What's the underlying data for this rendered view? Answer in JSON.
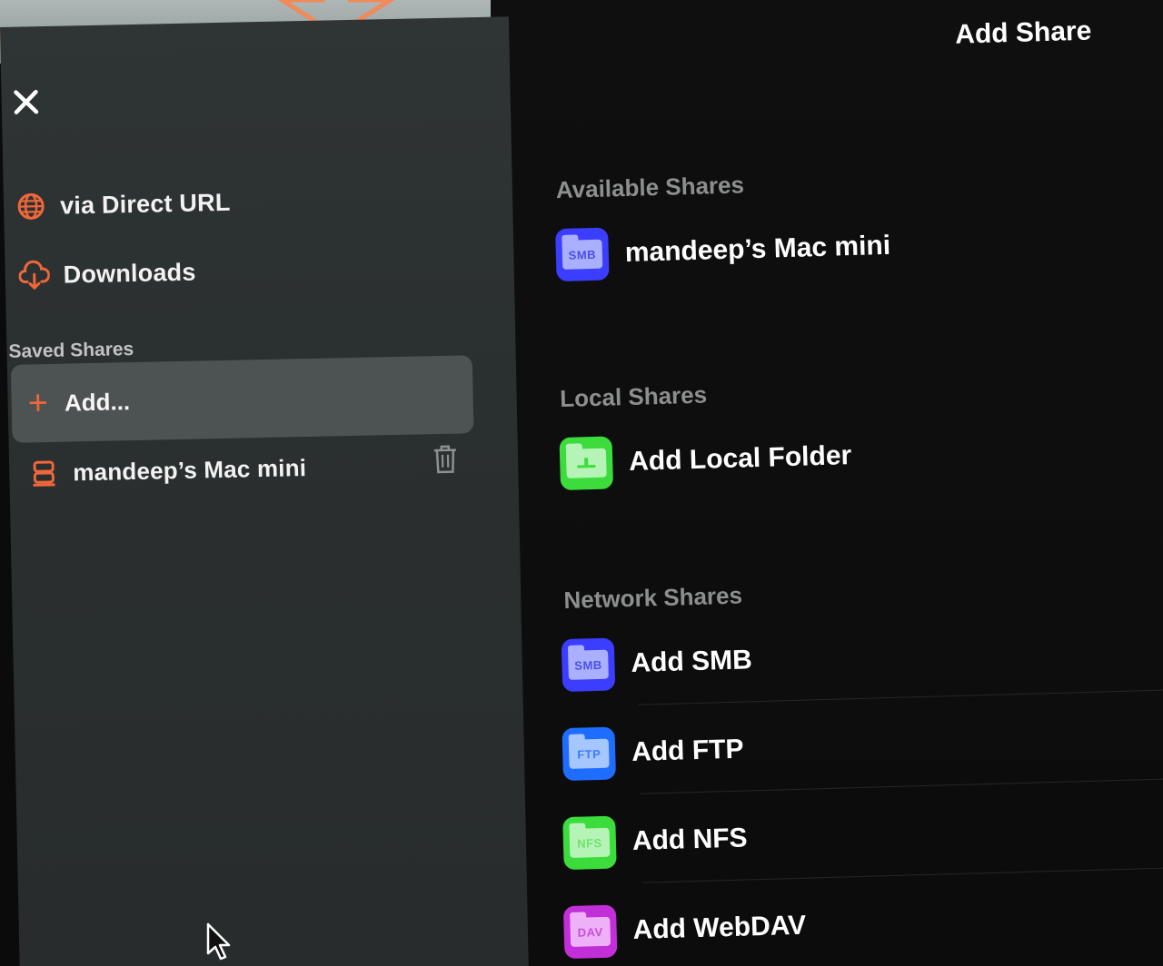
{
  "sidebar": {
    "nav_items": [
      {
        "label": "via Direct URL",
        "icon": "globe-icon"
      },
      {
        "label": "Downloads",
        "icon": "cloud-download-icon"
      }
    ],
    "section_title": "Saved Shares",
    "add_label": "Add...",
    "saved_items": [
      {
        "label": "mandeep’s Mac mini",
        "icon": "server-icon"
      }
    ]
  },
  "main": {
    "title": "Add Share",
    "groups": [
      {
        "label": "Available Shares",
        "items": [
          {
            "label": "mandeep’s Mac mini",
            "badge": "SMB",
            "color": "#3b3dff",
            "icon": "smb-folder-icon"
          }
        ]
      },
      {
        "label": "Local Shares",
        "items": [
          {
            "label": "Add Local Folder",
            "badge": "",
            "color": "#3ddc3d",
            "icon": "local-folder-icon"
          }
        ]
      },
      {
        "label": "Network Shares",
        "items": [
          {
            "label": "Add SMB",
            "badge": "SMB",
            "color": "#3b3dff",
            "icon": "smb-folder-icon"
          },
          {
            "label": "Add FTP",
            "badge": "FTP",
            "color": "#1f6dff",
            "icon": "ftp-folder-icon"
          },
          {
            "label": "Add NFS",
            "badge": "NFS",
            "color": "#3ddc3d",
            "icon": "nfs-folder-icon"
          },
          {
            "label": "Add WebDAV",
            "badge": "DAV",
            "color": "#c22ed8",
            "icon": "dav-folder-icon"
          }
        ]
      }
    ]
  },
  "colors": {
    "accent": "#f0673b",
    "sidebar_bg": "#2c3131",
    "main_bg": "#0c0c0c"
  }
}
